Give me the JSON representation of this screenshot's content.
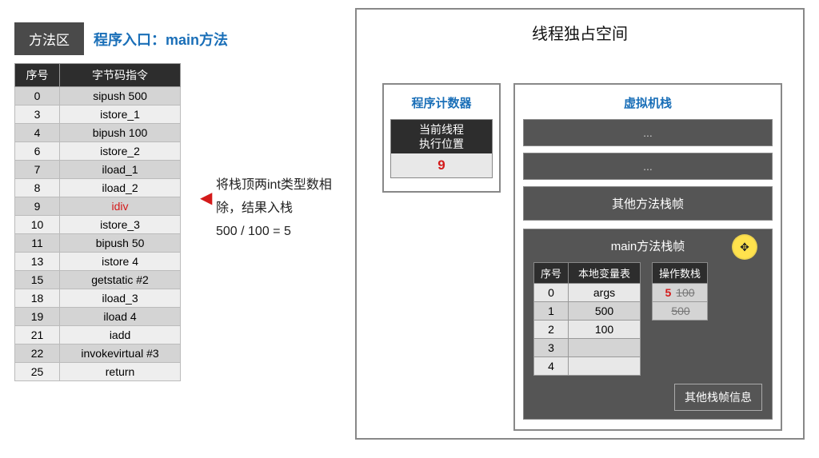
{
  "left": {
    "methodAreaTitle": "方法区",
    "entryLabel": "程序入口：main方法",
    "tableHeaders": {
      "seq": "序号",
      "instr": "字节码指令"
    },
    "bytecode": [
      {
        "seq": "0",
        "instr": "sipush 500"
      },
      {
        "seq": "3",
        "instr": "istore_1"
      },
      {
        "seq": "4",
        "instr": "bipush 100"
      },
      {
        "seq": "6",
        "instr": "istore_2"
      },
      {
        "seq": "7",
        "instr": "iload_1"
      },
      {
        "seq": "8",
        "instr": "iload_2"
      },
      {
        "seq": "9",
        "instr": "idiv",
        "highlight": true
      },
      {
        "seq": "10",
        "instr": "istore_3"
      },
      {
        "seq": "11",
        "instr": "bipush 50"
      },
      {
        "seq": "13",
        "instr": "istore 4"
      },
      {
        "seq": "15",
        "instr": "getstatic #2"
      },
      {
        "seq": "18",
        "instr": "iload_3"
      },
      {
        "seq": "19",
        "instr": "iload 4"
      },
      {
        "seq": "21",
        "instr": "iadd"
      },
      {
        "seq": "22",
        "instr": "invokevirtual #3"
      },
      {
        "seq": "25",
        "instr": "return"
      }
    ],
    "annotation": {
      "line1": "将栈顶两int类型数相",
      "line2": "除，结果入栈",
      "line3": "500 / 100 = 5"
    }
  },
  "right": {
    "threadTitle": "线程独占空间",
    "pc": {
      "title": "程序计数器",
      "label1": "当前线程",
      "label2": "执行位置",
      "value": "9"
    },
    "vmStack": {
      "title": "虚拟机栈",
      "slot1": "...",
      "slot2": "...",
      "otherFrames": "其他方法栈帧",
      "mainFrameTitle": "main方法栈帧",
      "localsHeaders": {
        "seq": "序号",
        "name": "本地变量表"
      },
      "locals": [
        {
          "seq": "0",
          "val": "args"
        },
        {
          "seq": "1",
          "val": "500"
        },
        {
          "seq": "2",
          "val": "100"
        },
        {
          "seq": "3",
          "val": ""
        },
        {
          "seq": "4",
          "val": ""
        }
      ],
      "opstackHeader": "操作数栈",
      "opstack": [
        {
          "red": "5",
          "strike": "100"
        },
        {
          "red": "",
          "strike": "500"
        }
      ],
      "otherInfo": "其他栈帧信息"
    }
  }
}
